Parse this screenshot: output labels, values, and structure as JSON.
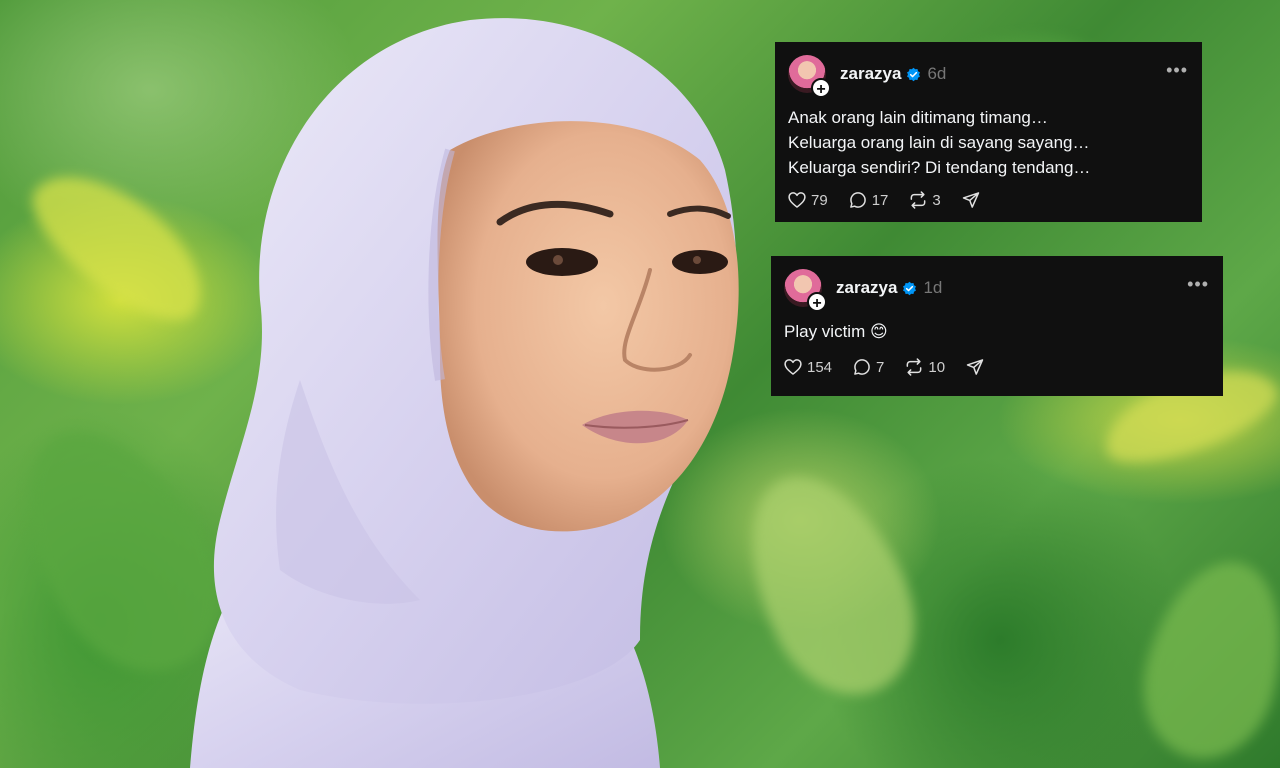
{
  "posts": [
    {
      "username": "zarazya",
      "time": "6d",
      "lines": [
        "Anak orang lain ditimang timang…",
        "Keluarga orang lain di sayang sayang…",
        "Keluarga sendiri? Di tendang tendang…"
      ],
      "likes": "79",
      "replies": "17",
      "reposts": "3"
    },
    {
      "username": "zarazya",
      "time": "1d",
      "lines": [
        "Play victim 😊"
      ],
      "likes": "154",
      "replies": "7",
      "reposts": "10"
    }
  ],
  "icons": {
    "verified": "verified-badge-icon",
    "more": "more-options-icon",
    "like": "heart-icon",
    "reply": "speech-bubble-icon",
    "repost": "repost-arrows-icon",
    "share": "paper-plane-icon",
    "add": "plus-icon"
  },
  "colors": {
    "card_bg": "#101010",
    "text": "#f3f5f7",
    "muted": "#777777",
    "verified_blue": "#0095f6"
  }
}
